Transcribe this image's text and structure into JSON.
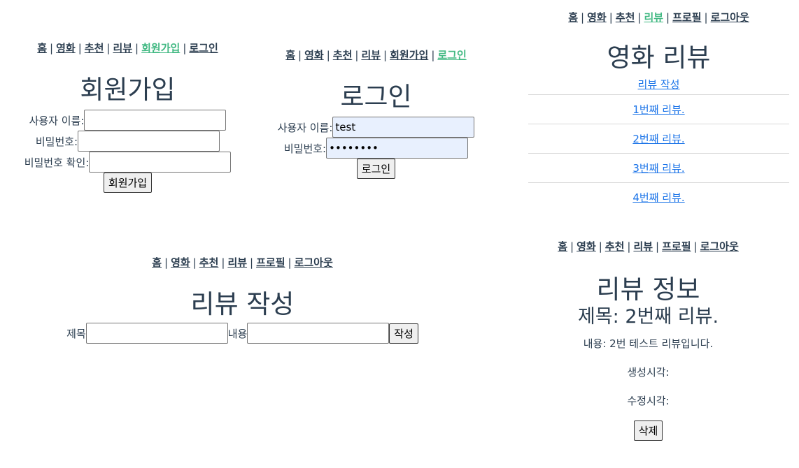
{
  "nav_items": [
    "홈",
    "영화",
    "추천",
    "리뷰",
    "회원가입",
    "로그인",
    "프로필",
    "로그아웃"
  ],
  "signup": {
    "title": "회원가입",
    "username_label": "사용자 이름:",
    "password_label": "비밀번호:",
    "password_confirm_label": "비밀번호 확인:",
    "submit_label": "회원가입"
  },
  "login": {
    "title": "로그인",
    "username_label": "사용자 이름:",
    "username_value": "test",
    "password_label": "비밀번호:",
    "password_value": "12345678",
    "submit_label": "로그인"
  },
  "review_list": {
    "title": "영화 리뷰",
    "write_link": "리뷰 작성",
    "items": [
      "1번째 리뷰.",
      "2번째 리뷰.",
      "3번째 리뷰.",
      "4번째 리뷰."
    ]
  },
  "review_write": {
    "title": "리뷰 작성",
    "title_label": "제목",
    "content_label": "내용",
    "submit_label": "작성"
  },
  "review_detail": {
    "title": "리뷰 정보",
    "subject": "제목: 2번째 리뷰.",
    "content": "내용: 2번 테스트 리뷰입니다.",
    "created_label": "생성시각:",
    "updated_label": "수정시각:",
    "delete_label": "삭제"
  },
  "colors": {
    "active_nav": "#42b983",
    "text": "#2c3e50",
    "link": "#1a73e8",
    "autofill": "#e8f0fe"
  }
}
